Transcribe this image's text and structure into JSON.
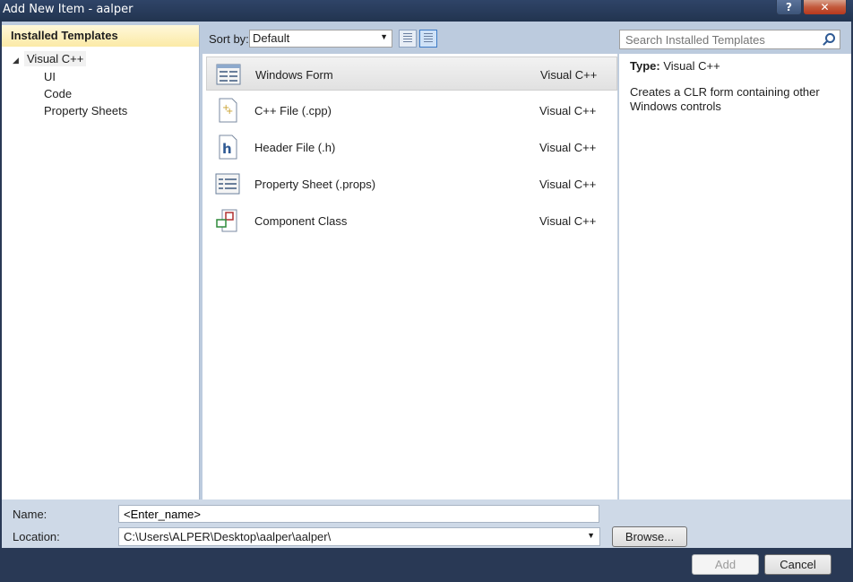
{
  "window": {
    "title": "Add New Item - aalper",
    "help_label": "?",
    "close_label": "✕"
  },
  "templates_tree": {
    "header": "Installed Templates",
    "expander": "◢",
    "root": "Visual C++",
    "children": [
      "UI",
      "Code",
      "Property Sheets"
    ]
  },
  "toolbar": {
    "sort_label": "Sort by:",
    "sort_value": "Default",
    "search_placeholder": "Search Installed Templates"
  },
  "templates": [
    {
      "name": "Windows Form",
      "language": "Visual C++",
      "icon": "windows-form-icon",
      "selected": true
    },
    {
      "name": "C++ File (.cpp)",
      "language": "Visual C++",
      "icon": "cpp-file-icon",
      "selected": false
    },
    {
      "name": "Header File (.h)",
      "language": "Visual C++",
      "icon": "header-file-icon",
      "selected": false
    },
    {
      "name": "Property Sheet (.props)",
      "language": "Visual C++",
      "icon": "property-sheet-icon",
      "selected": false
    },
    {
      "name": "Component Class",
      "language": "Visual C++",
      "icon": "component-class-icon",
      "selected": false
    }
  ],
  "details": {
    "type_key": "Type:",
    "type_value": "Visual C++",
    "description": "Creates a CLR form containing other Windows controls"
  },
  "form": {
    "name_label": "Name:",
    "name_value": "<Enter_name>",
    "location_label": "Location:",
    "location_value": "C:\\Users\\ALPER\\Desktop\\aalper\\aalper\\",
    "browse_label": "Browse..."
  },
  "buttons": {
    "add_label": "Add",
    "cancel_label": "Cancel"
  },
  "colors": {
    "chrome": "#293955",
    "panel_bg": "#bccbde",
    "header_yellow": "#fbeaa6"
  }
}
